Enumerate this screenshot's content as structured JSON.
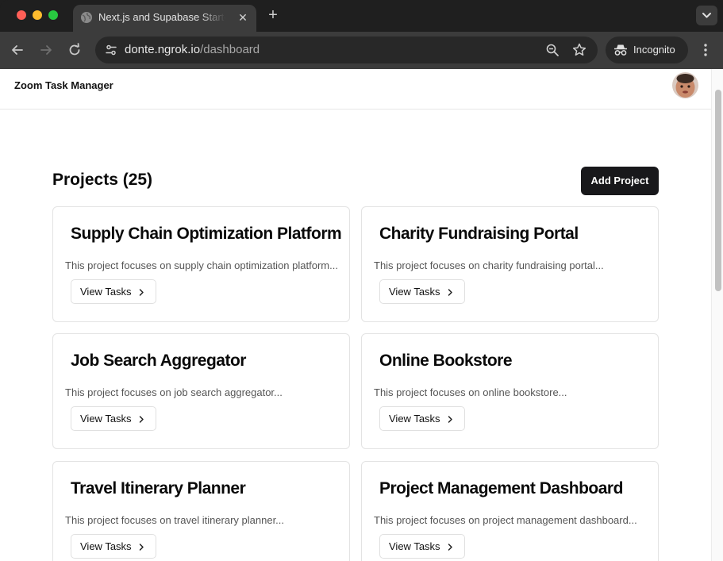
{
  "browser": {
    "tab_title": "Next.js and Supabase Starter Kit",
    "url_host": "donte.ngrok.io",
    "url_path": "/dashboard",
    "incognito_label": "Incognito"
  },
  "app": {
    "title": "Zoom Task Manager"
  },
  "projects": {
    "heading": "Projects (25)",
    "add_button": "Add Project",
    "view_tasks_label": "View Tasks",
    "items": [
      {
        "name": "Supply Chain Optimization Platform",
        "description": "This project focuses on supply chain optimization platform..."
      },
      {
        "name": "Charity Fundraising Portal",
        "description": "This project focuses on charity fundraising portal..."
      },
      {
        "name": "Job Search Aggregator",
        "description": "This project focuses on job search aggregator..."
      },
      {
        "name": "Online Bookstore",
        "description": "This project focuses on online bookstore..."
      },
      {
        "name": "Travel Itinerary Planner",
        "description": "This project focuses on travel itinerary planner..."
      },
      {
        "name": "Project Management Dashboard",
        "description": "This project focuses on project management dashboard..."
      }
    ]
  }
}
